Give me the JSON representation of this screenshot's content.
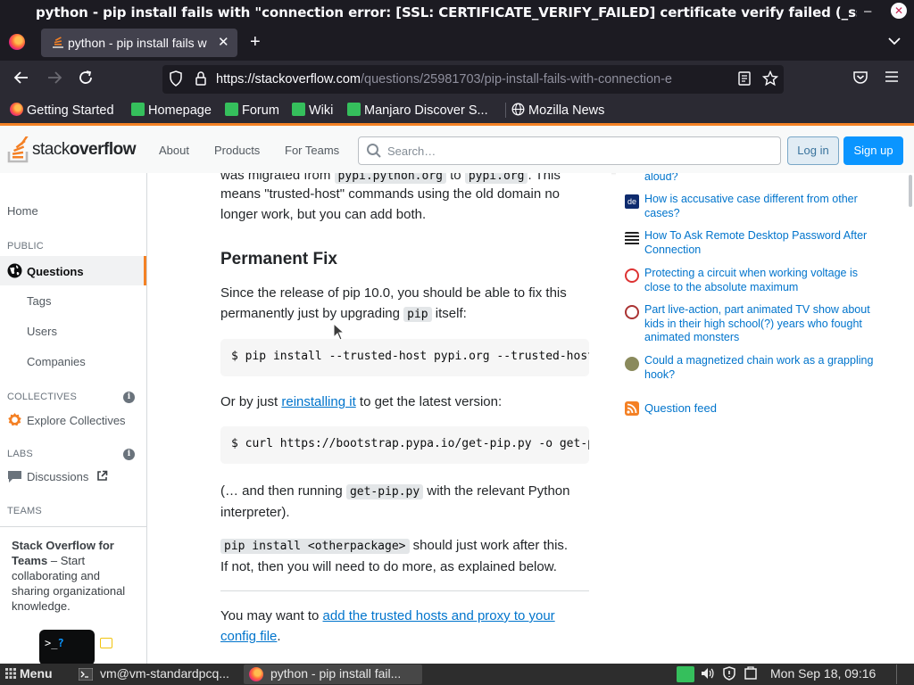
{
  "window": {
    "title": "python - pip install fails with \"connection error: [SSL: CERTIFICATE_VERIFY_FAILED] certificate verify failed (_ssl.c...",
    "minimize": "–",
    "close": "✕"
  },
  "tabs": [
    {
      "label": "python - pip install fails w",
      "close": "✕"
    }
  ],
  "new_tab": "+",
  "tab_list": "⌄",
  "nav": {
    "url_host": "https://stackoverflow.com",
    "url_path": "/questions/25981703/pip-install-fails-with-connection-e"
  },
  "bookmarks": [
    "Getting Started",
    "Homepage",
    "Forum",
    "Wiki",
    "Manjaro Discover S...",
    "Mozilla News"
  ],
  "so_header": {
    "logo_light": "stack",
    "logo_bold": "overflow",
    "nav": [
      "About",
      "Products",
      "For Teams"
    ],
    "search_placeholder": "Search…",
    "login": "Log in",
    "signup": "Sign up"
  },
  "left_nav": {
    "home": "Home",
    "public_label": "PUBLIC",
    "questions": "Questions",
    "tags": "Tags",
    "users": "Users",
    "companies": "Companies",
    "collectives_label": "COLLECTIVES",
    "explore_collectives": "Explore Collectives",
    "labs_label": "LABS",
    "discussions": "Discussions",
    "teams_label": "TEAMS",
    "teams_title": "Stack Overflow for Teams",
    "teams_text": " – Start collaborating and sharing organizational knowledge."
  },
  "main": {
    "p0_a": "was migrated from ",
    "p0_code1": "pypi.python.org",
    "p0_b": " to ",
    "p0_code2": "pypi.org",
    "p0_c": ". This",
    "p1": "means \"trusted-host\" commands using the old domain no longer work, but you can add both.",
    "heading": "Permanent Fix",
    "p2_a": "Since the release of pip 10.0, you should be able to fix this permanently just by upgrading ",
    "p2_code": "pip",
    "p2_b": " itself:",
    "code1": "$ pip install --trusted-host pypi.org --trusted-host",
    "p3_a": "Or by just ",
    "p3_link": "reinstalling it",
    "p3_b": " to get the latest version:",
    "code2": "$ curl https://bootstrap.pypa.io/get-pip.py -o get-p",
    "p4_a": "(… and then running ",
    "p4_code": "get-pip.py",
    "p4_b": " with the relevant Python interpreter).",
    "p5_code": "pip install <otherpackage>",
    "p5_b": " should just work after this. If not, then you will need to do more, as explained below.",
    "p6_a": "You may want to ",
    "p6_link": "add the trusted hosts and proxy to your config file",
    "p6_b": "."
  },
  "hot_questions": [
    {
      "title": "aloud?"
    },
    {
      "title": "How is accusative case different from other cases?",
      "icon_text": "de"
    },
    {
      "title": "How To Ask Remote Desktop Password After Connection"
    },
    {
      "title": "Protecting a circuit when working voltage is close to the absolute maximum"
    },
    {
      "title": "Part live-action, part animated TV show about kids in their high school(?) years who fought animated monsters"
    },
    {
      "title": "Could a magnetized chain work as a grappling hook?"
    }
  ],
  "question_feed": "Question feed",
  "taskbar": {
    "menu": "Menu",
    "terminal": "vm@vm-standardpcq...",
    "firefox": "python - pip install fail...",
    "clock": "Mon Sep 18, 09:16"
  }
}
